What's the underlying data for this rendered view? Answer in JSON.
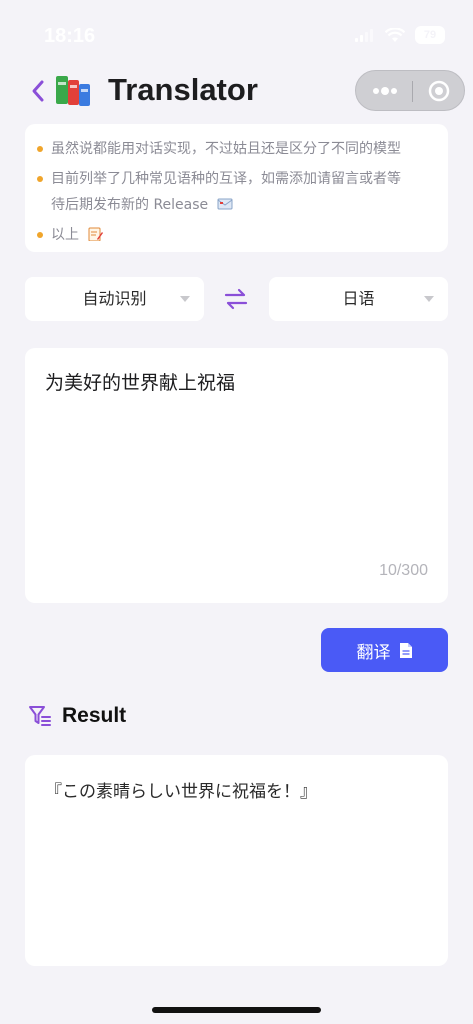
{
  "status": {
    "time": "18:16",
    "battery": "79"
  },
  "header": {
    "title": "Translator",
    "app_icon": "books-icon"
  },
  "notes": [
    {
      "text": "虽然说都能用对话实现，不过姑且还是区分了不同的模型",
      "emoji": ""
    },
    {
      "text": "目前列举了几种常见语种的互译，如需添加请留言或者等",
      "emoji": ""
    },
    {
      "text": "待后期发布新的 Release",
      "emoji": "envelope-icon"
    },
    {
      "text": "以上",
      "emoji": "memo-icon"
    }
  ],
  "languages": {
    "source": "自动识别",
    "target": "日语"
  },
  "input": {
    "text": "为美好的世界献上祝福",
    "counter": "10/300"
  },
  "translate_button": {
    "label": "翻译"
  },
  "result": {
    "title": "Result",
    "text": "『この素晴らしい世界に祝福を！』"
  },
  "colors": {
    "accent": "#4a5af6",
    "purple": "#8a4fd8",
    "dot": "#f0a52b",
    "background": "#f4f3f8"
  }
}
